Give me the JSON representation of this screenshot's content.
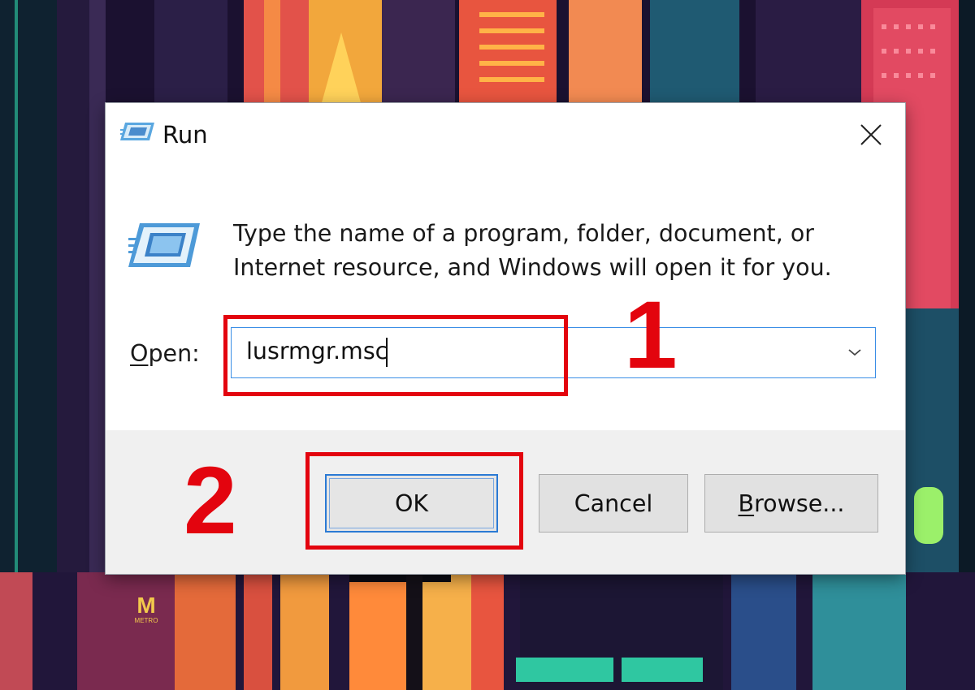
{
  "dialog": {
    "title": "Run",
    "description_line1": "Type the name of a program, folder, document, or",
    "description_line2": "Internet resource, and Windows will open it for you.",
    "open_label_mnemonic": "O",
    "open_label_rest": "pen:",
    "open_value": "lusrmgr.msc",
    "buttons": {
      "ok": "OK",
      "cancel": "Cancel",
      "browse_mnemonic": "B",
      "browse_rest": "rowse..."
    },
    "icons": {
      "title": "run-icon",
      "body": "run-icon",
      "close": "close-icon",
      "dropdown": "chevron-down-icon"
    }
  },
  "annotations": {
    "step1": "1",
    "step2": "2",
    "color": "#e3040e"
  },
  "wallpaper": {
    "sign_letter": "M",
    "sign_text": "METRO"
  }
}
